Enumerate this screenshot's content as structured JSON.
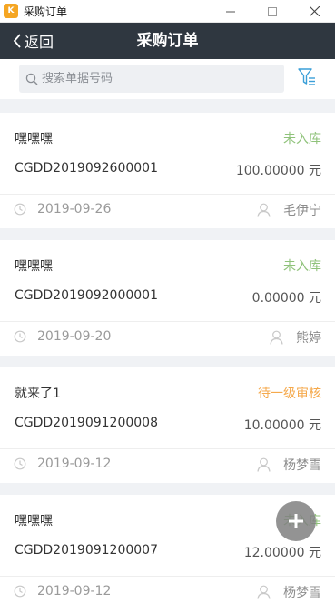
{
  "window": {
    "title": "采购订单",
    "icon": "app-logo-icon",
    "controls": [
      "minimize-icon",
      "maximize-icon",
      "close-icon"
    ]
  },
  "navbar": {
    "back_label": "返回",
    "title": "采购订单"
  },
  "search": {
    "placeholder": "搜索单据号码",
    "value": ""
  },
  "colors": {
    "navbar_bg": "#2f3740",
    "status_green": "#8fc27a",
    "status_orange": "#f5a94c",
    "fab_gray": "#808080"
  },
  "orders": [
    {
      "name": "嘿嘿嘿",
      "status": "未入库",
      "status_color": "#8fc27a",
      "code": "CGDD2019092600001",
      "amount": "100.00000 元",
      "date": "2019-09-26",
      "person": "毛伊宁"
    },
    {
      "name": "嘿嘿嘿",
      "status": "未入库",
      "status_color": "#8fc27a",
      "code": "CGDD2019092000001",
      "amount": "0.00000 元",
      "date": "2019-09-20",
      "person": "熊婷"
    },
    {
      "name": "就来了1",
      "status": "待一级审核",
      "status_color": "#f5a94c",
      "code": "CGDD2019091200008",
      "amount": "10.00000 元",
      "date": "2019-09-12",
      "person": "杨梦雪"
    },
    {
      "name": "嘿嘿嘿",
      "status": "未入库",
      "status_color": "#8fc27a",
      "code": "CGDD2019091200007",
      "amount": "12.00000 元",
      "date": "2019-09-12",
      "person": "杨梦雪"
    }
  ],
  "fab": {
    "icon": "plus-icon"
  }
}
